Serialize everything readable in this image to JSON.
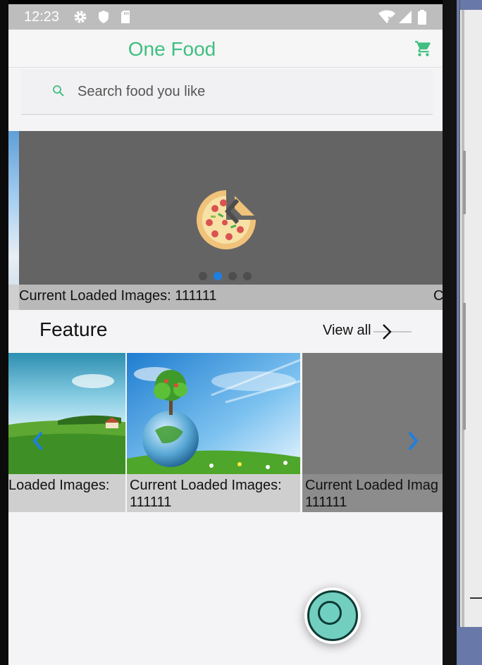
{
  "status_bar": {
    "time": "12:23",
    "icons": [
      "gear-icon",
      "shield-icon",
      "sdcard-icon",
      "wifi-icon",
      "signal-icon",
      "battery-icon"
    ]
  },
  "app_bar": {
    "title": "One Food",
    "cart_icon": "cart-icon"
  },
  "search": {
    "placeholder": "Search food you like",
    "icon": "search-icon"
  },
  "carousel": {
    "caption": "Current Loaded Images: 111111",
    "right_caption": "C",
    "center_icon": "pizza-icon",
    "dot_count": 4,
    "active_dot": 1
  },
  "feature": {
    "title": "Feature",
    "view_all_label": "View all"
  },
  "gallery": {
    "cards": [
      {
        "caption_line1": "Loaded Images:",
        "caption_line2": ""
      },
      {
        "caption_line1": "Current Loaded Images:",
        "caption_line2": "111111"
      },
      {
        "caption_line1": "Current Loaded Imag",
        "caption_line2": "111111"
      }
    ],
    "prev_icon": "chevron-left-icon",
    "next_icon": "chevron-right-icon"
  },
  "colors": {
    "accent": "#3fbf80",
    "carousel_dot_active": "#1e7fe0",
    "fab": "#72cfc0"
  }
}
